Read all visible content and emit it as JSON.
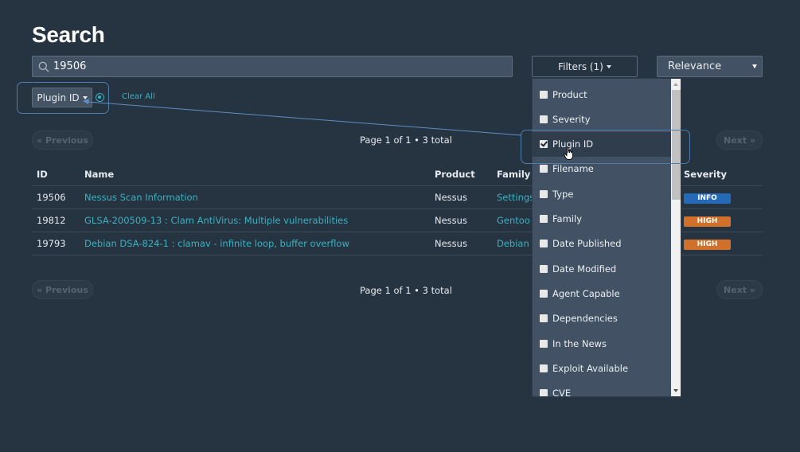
{
  "page": {
    "title": "Search"
  },
  "search": {
    "value": "19506",
    "icon": "search-icon"
  },
  "active_filters": {
    "chip_label": "Plugin ID",
    "clear_all_label": "Clear All"
  },
  "toolbar": {
    "filters_label": "Filters (1)",
    "sort_selected": "Relevance"
  },
  "pagination_top": {
    "previous_label": "« Previous",
    "next_label": "Next »",
    "info": "Page 1 of 1 • 3 total"
  },
  "pagination_bottom": {
    "previous_label": "« Previous",
    "next_label": "Next »",
    "info": "Page 1 of 1 • 3 total"
  },
  "table": {
    "columns": [
      "ID",
      "Name",
      "Product",
      "Family",
      "Severity"
    ],
    "rows": [
      {
        "id": "19506",
        "name": "Nessus Scan Information",
        "product": "Nessus",
        "family": "Settings",
        "severity": "INFO",
        "severity_color": "#2569b9"
      },
      {
        "id": "19812",
        "name": "GLSA-200509-13 : Clam AntiVirus: Multiple vulnerabilities",
        "product": "Nessus",
        "family": "Gentoo Local Security Checks",
        "severity": "HIGH",
        "severity_color": "#d0702a"
      },
      {
        "id": "19793",
        "name": "Debian DSA-824-1 : clamav - infinite loop, buffer overflow",
        "product": "Nessus",
        "family": "Debian Local Security Checks",
        "severity": "HIGH",
        "severity_color": "#d0702a"
      }
    ]
  },
  "filter_menu": {
    "items": [
      {
        "label": "Product",
        "checked": false
      },
      {
        "label": "Severity",
        "checked": false
      },
      {
        "label": "Plugin ID",
        "checked": true
      },
      {
        "label": "Filename",
        "checked": false
      },
      {
        "label": "Type",
        "checked": false
      },
      {
        "label": "Family",
        "checked": false
      },
      {
        "label": "Date Published",
        "checked": false
      },
      {
        "label": "Date Modified",
        "checked": false
      },
      {
        "label": "Agent Capable",
        "checked": false
      },
      {
        "label": "Dependencies",
        "checked": false
      },
      {
        "label": "In the News",
        "checked": false
      },
      {
        "label": "Exploit Available",
        "checked": false
      },
      {
        "label": "CVE",
        "checked": false
      }
    ]
  },
  "colors": {
    "accent": "#3ab1c1",
    "background": "#263341",
    "panel": "#425163",
    "annotation": "#4e7eaa"
  }
}
